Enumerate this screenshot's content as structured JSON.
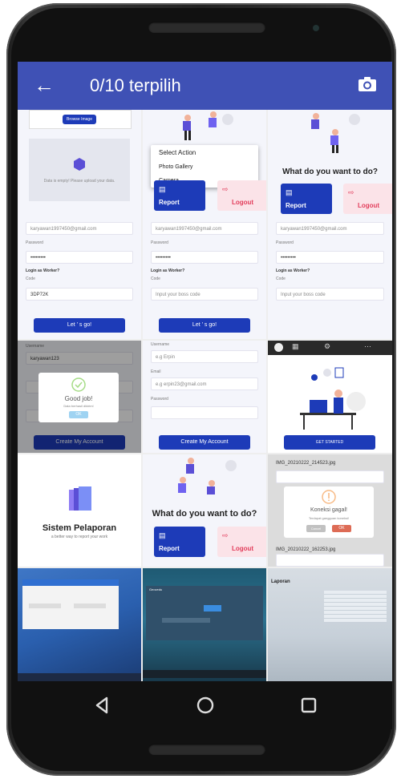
{
  "appbar": {
    "title": "0/10 terpilih",
    "back_icon": "arrow-left-icon",
    "camera_icon": "camera-icon",
    "color": "#3f51b5"
  },
  "cell1": {
    "upload_btn": "Browse Image",
    "empty_text": "Data is empty! Please upload your data.",
    "email": "karyawan1997450@gmail.com",
    "password_label": "Password",
    "password": "•••••••••",
    "login_as": "Login as Worker?",
    "code_label": "Code",
    "code": "3DP72K",
    "login_btn": "Let ' s go!"
  },
  "cell2": {
    "menu_title": "Select Action",
    "menu_items": [
      "Photo Gallery",
      "Camera"
    ],
    "report": "Report",
    "logout": "Logout",
    "email": "karyawan1997450@gmail.com",
    "password_label": "Password",
    "password": "•••••••••",
    "login_as": "Login as Worker?",
    "code_label": "Code",
    "code_placeholder": "Input your boss code",
    "login_btn": "Let ' s go!"
  },
  "cell3": {
    "question": "What do you want to do?",
    "report": "Report",
    "logout": "Logout",
    "email": "karyawan1997450@gmail.com",
    "password_label": "Password",
    "password": "•••••••••",
    "login_as": "Login as Worker?",
    "code_label": "Code",
    "code_placeholder": "Input your boss code"
  },
  "cell4": {
    "username_label": "Username",
    "username": "karyawan123",
    "dialog_title": "Good job!",
    "dialog_text": "Data berhasil dikirim!",
    "ok": "OK",
    "create_btn": "Create My Account"
  },
  "cell5": {
    "username_label": "Username",
    "username_placeholder": "e.g Erpin",
    "email_label": "Email",
    "email_placeholder": "e.g erpin23@gmail.com",
    "password_label": "Password",
    "create_btn": "Create My Account"
  },
  "cell6": {
    "get_started": "GET STARTED"
  },
  "cell7": {
    "title": "Sistem Pelaporan",
    "subtitle": "a better way to report your work"
  },
  "cell8": {
    "question": "What do you want to do?",
    "report": "Report",
    "logout": "Logout"
  },
  "cell9": {
    "file1": "IMG_20210222_214523.jpg",
    "file2": "IMG_20210222_162253.jpg",
    "dialog_title": "Koneksi gagal!",
    "dialog_text": "Terdapat gangguan koneksi!",
    "ok": "OK",
    "cancel": "Cancel"
  },
  "cell11": {
    "title": "Geovedu"
  },
  "cell12": {
    "title": "Laporan"
  },
  "navbar": {
    "back_icon": "triangle-back-icon",
    "home_icon": "circle-home-icon",
    "recents_icon": "square-recents-icon"
  }
}
